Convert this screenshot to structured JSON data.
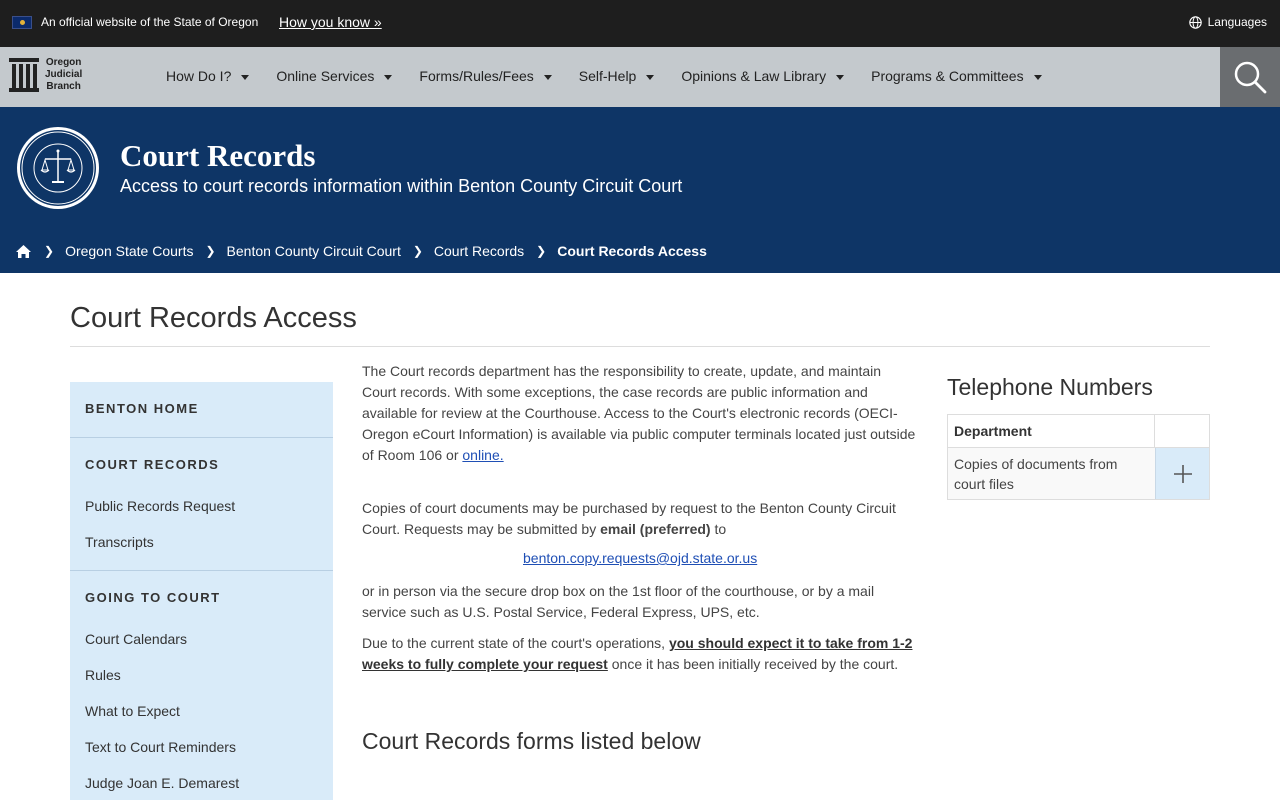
{
  "gov_banner": {
    "official_text": "An official website of the State of Oregon",
    "how_you_know": "How you know »",
    "languages": "Languages"
  },
  "logo": {
    "line1": "Oregon",
    "line2": "Judicial",
    "line3": "Branch"
  },
  "nav": {
    "items": [
      {
        "label": "How Do I?"
      },
      {
        "label": "Online Services"
      },
      {
        "label": "Forms/Rules/Fees"
      },
      {
        "label": "Self-Help"
      },
      {
        "label": "Opinions & Law Library"
      },
      {
        "label": "Programs & Committees"
      }
    ]
  },
  "hero": {
    "title": "Court Records",
    "subtitle": "Access to court records information within Benton County Circuit Court"
  },
  "breadcrumb": {
    "items": [
      {
        "label": "Oregon State Courts"
      },
      {
        "label": "Benton County Circuit Court"
      },
      {
        "label": "Court Records"
      },
      {
        "label": "Court Records Access"
      }
    ]
  },
  "page": {
    "title": "Court Records Access"
  },
  "sidebar": {
    "benton_home": "BENTON HOME",
    "court_records_head": "COURT RECORDS",
    "public_records": "Public Records Request",
    "transcripts": "Transcripts",
    "going_to_court_head": "GOING TO COURT",
    "court_calendars": "Court Calendars",
    "rules": "Rules",
    "what_to_expect": "What to Expect",
    "text_reminders": "Text to Court Reminders",
    "judge": "Judge Joan E. Demarest"
  },
  "content": {
    "p1_text": "The Court records department has the responsibility to create, update, and maintain Court records.  With some exceptions, the case records are public information and available for review at the Courthouse.   Access to the Court's electronic records (OECI-Oregon eCourt Information) is available via public computer terminals located just outside of Room 106 or ",
    "p1_link": "online.",
    "p2_text": "Copies of court documents may be purchased by request to the Benton County Circuit Court.  Requests may be submitted by ",
    "p2_bold": "email (preferred)",
    "p2_end": " to",
    "email": "benton.copy.requests@ojd.state.or.us",
    "p3": "or in person via the secure drop box on the 1st floor of the courthouse, or by a mail service such as U.S. Postal Service, Federal Express, UPS, etc.",
    "p4_start": "Due to the current state of the court's operations, ",
    "p4_bold": "you should expect it to take from 1-2 weeks to fully complete your request",
    "p4_end": " once it has been initially received by the court.",
    "forms_heading": "Court Records forms listed below"
  },
  "phone": {
    "heading": "Telephone Numbers",
    "col_department": "Department",
    "row1_label": "Copies of documents from court files"
  }
}
